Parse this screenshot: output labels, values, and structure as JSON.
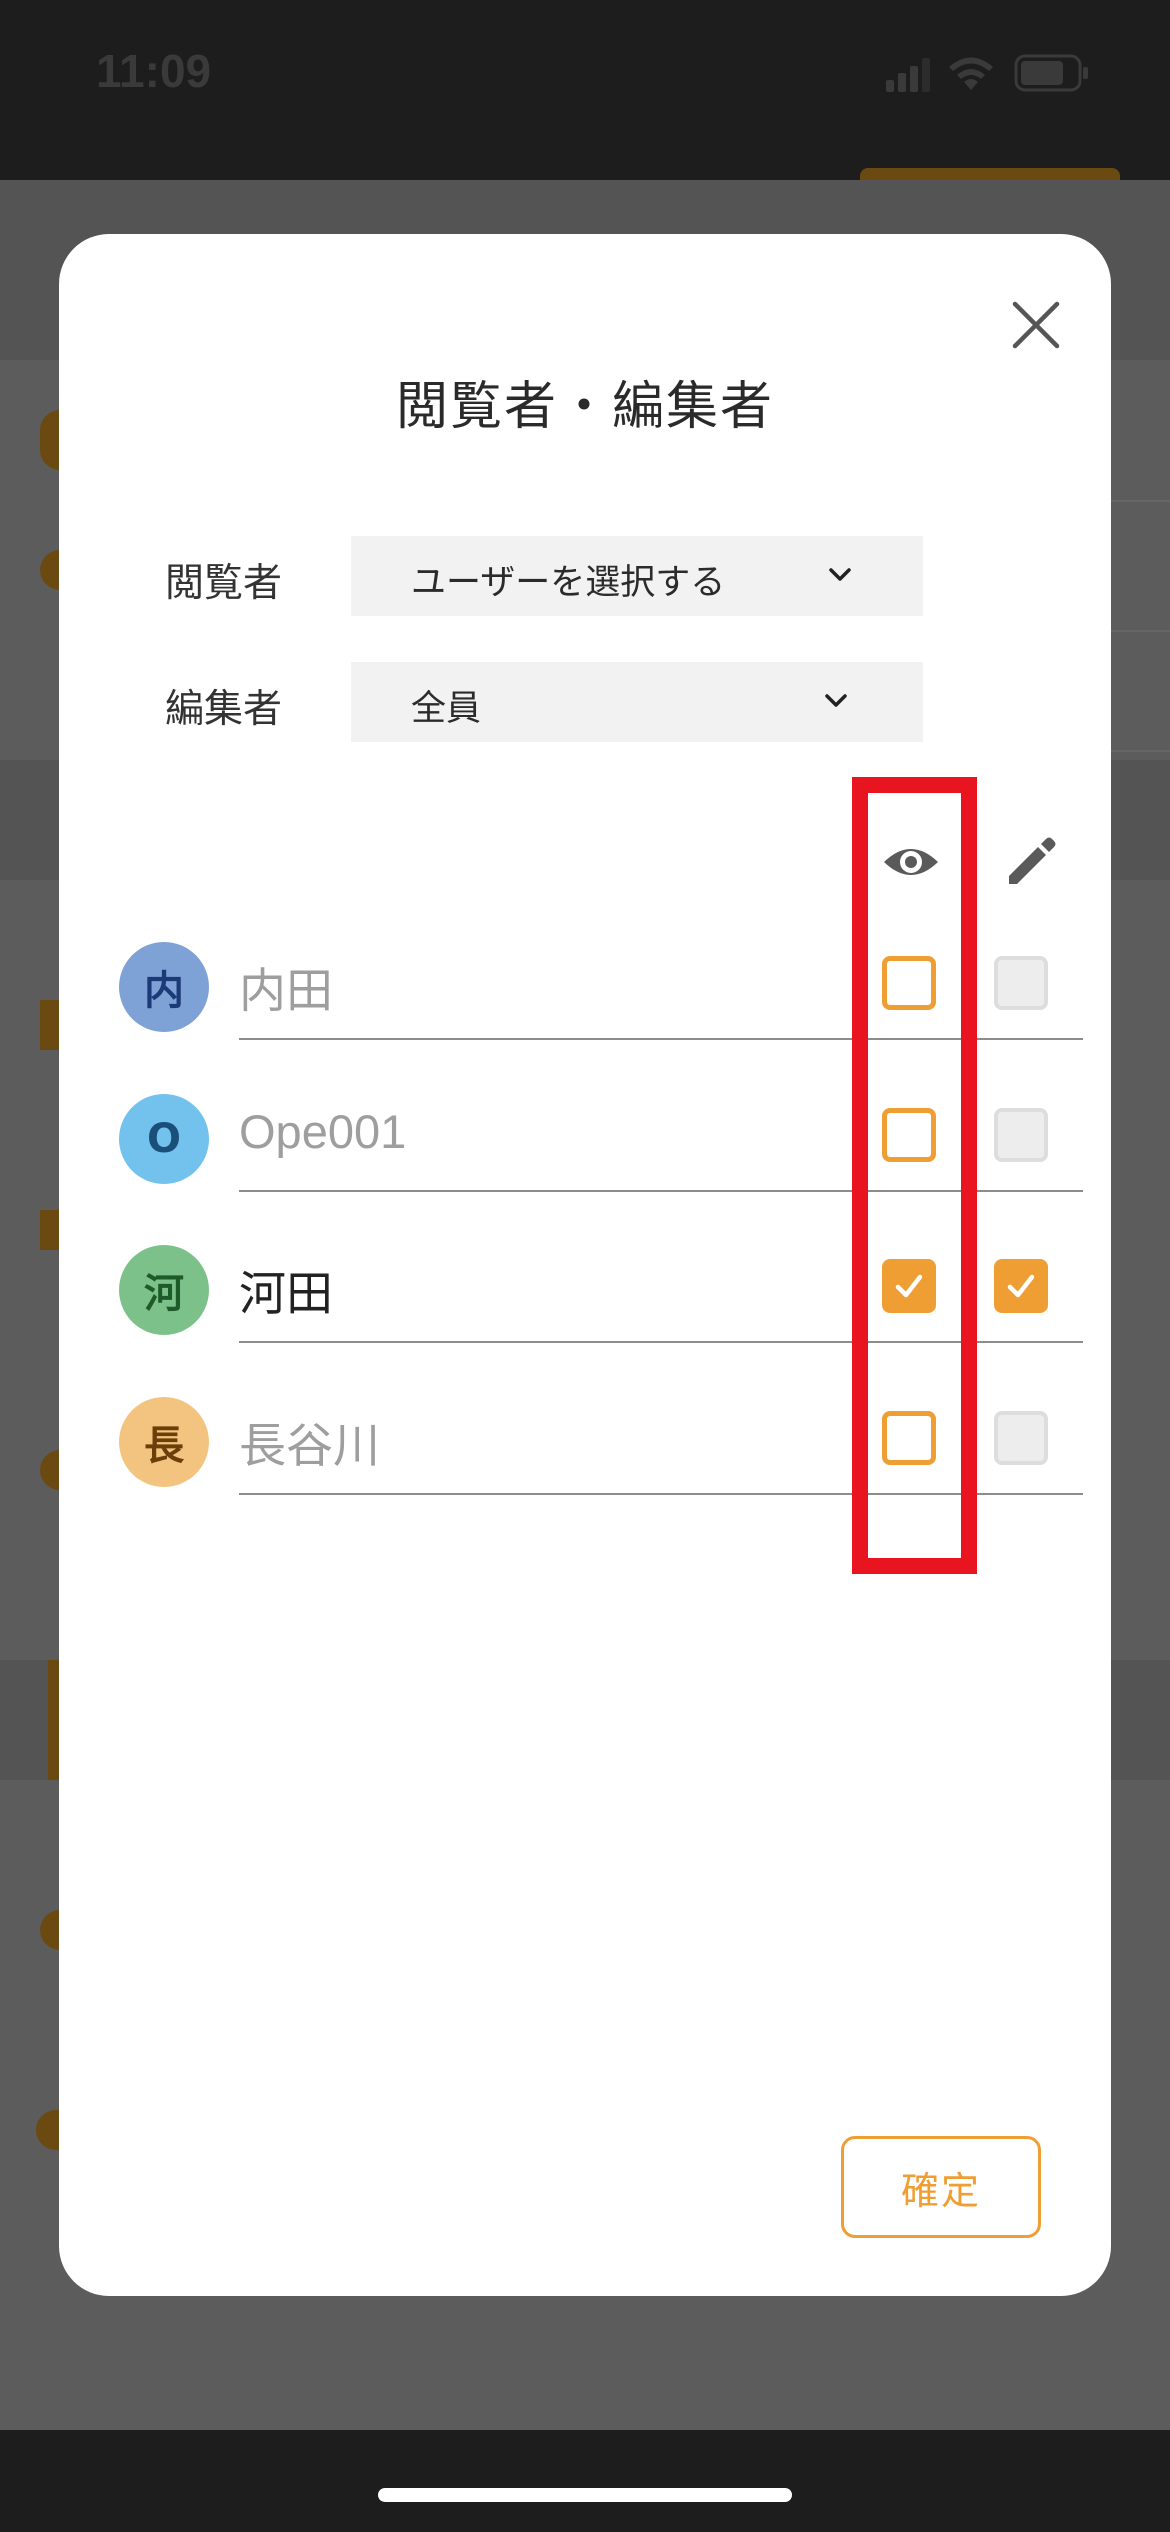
{
  "status_bar": {
    "time": "11:09",
    "icons": [
      "cellular-signal-icon",
      "wifi-icon",
      "battery-icon"
    ]
  },
  "modal": {
    "title": "閲覧者・編集者",
    "viewer_label": "閲覧者",
    "viewer_value": "ユーザーを選択する",
    "editor_label": "編集者",
    "editor_value": "全員",
    "column_icons": {
      "view": "eye-icon",
      "edit": "pencil-icon"
    },
    "users": [
      {
        "avatar": "内",
        "name": "内田",
        "view": false,
        "edit": false,
        "avatar_bg": "#7ea2d6",
        "avatar_fg": "#1c3a78",
        "active": false
      },
      {
        "avatar": "O",
        "name": "Ope001",
        "view": false,
        "edit": false,
        "avatar_bg": "#73c2ee",
        "avatar_fg": "#1a4f7a",
        "active": false
      },
      {
        "avatar": "河",
        "name": "河田",
        "view": true,
        "edit": true,
        "avatar_bg": "#7dc18a",
        "avatar_fg": "#1f5a2a",
        "active": true
      },
      {
        "avatar": "長",
        "name": "長谷川",
        "view": false,
        "edit": false,
        "avatar_bg": "#f3c47f",
        "avatar_fg": "#6b3f0a",
        "active": false
      }
    ],
    "confirm_label": "確定"
  },
  "colors": {
    "accent": "#ef9e34",
    "highlight": "#e8141f",
    "inactive_text": "#9e9e9e",
    "active_text": "#222222"
  }
}
